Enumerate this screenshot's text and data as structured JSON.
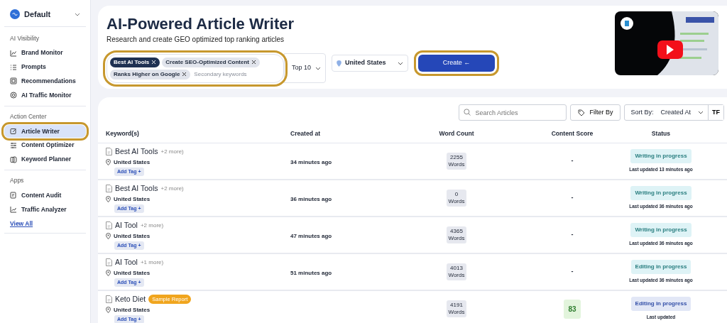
{
  "workspace": {
    "name": "Default"
  },
  "sidebar": {
    "sections": [
      {
        "title": "AI Visibility",
        "items": [
          {
            "label": "Brand Monitor",
            "selected": false
          },
          {
            "label": "Prompts",
            "selected": false
          },
          {
            "label": "Recommendations",
            "selected": false
          },
          {
            "label": "AI Traffic Monitor",
            "selected": false
          }
        ]
      },
      {
        "title": "Action Center",
        "items": [
          {
            "label": "Article Writer",
            "selected": true
          },
          {
            "label": "Content Optimizer",
            "selected": false
          },
          {
            "label": "Keyword Planner",
            "selected": false
          }
        ]
      },
      {
        "title": "Apps",
        "items": [
          {
            "label": "Content Audit",
            "selected": false
          },
          {
            "label": "Traffic Analyzer",
            "selected": false
          }
        ]
      }
    ],
    "view_all": "View All"
  },
  "header": {
    "title": "AI-Powered Article Writer",
    "subtitle": "Research and create GEO optimized top ranking articles"
  },
  "form": {
    "keywords": [
      {
        "label": "Best AI Tools",
        "primary": true
      },
      {
        "label": "Create SEO-Optimized Content",
        "primary": false
      },
      {
        "label": "Ranks Higher on Google",
        "primary": false
      }
    ],
    "secondary_placeholder": "Secondary keywords",
    "top": "Top 10",
    "location": "United States",
    "create_button": "Create ←"
  },
  "toolbar": {
    "search_placeholder": "Search Articles",
    "filter": "Filter By",
    "sort_label": "Sort By:",
    "sort_value": "Created At",
    "tf": "TF"
  },
  "table": {
    "columns": [
      "Keyword(s)",
      "Created at",
      "Word Count",
      "Content Score",
      "Status"
    ],
    "rows": [
      {
        "keyword": "Best AI Tools",
        "more": "+2 more)",
        "tag": null,
        "location": "United States",
        "add_tag": "Add Tag +",
        "created": "34 minutes ago",
        "words": "2255",
        "words_unit": "Words",
        "score": "-",
        "score_highlighted": false,
        "status": "Writing in progress",
        "color": "#def3f6",
        "updated": "Last updated 13 minutes ago"
      },
      {
        "keyword": "Best AI Tools",
        "more": "+2 more)",
        "tag": null,
        "location": "United States",
        "add_tag": "Add Tag +",
        "created": "36 minutes ago",
        "words": "0",
        "words_unit": "Words",
        "score": "-",
        "score_highlighted": false,
        "status": "Writing in progress",
        "color": "#def3f6",
        "updated": "Last updated 36 minutes ago"
      },
      {
        "keyword": "AI Tool",
        "more": "+2 more)",
        "tag": null,
        "location": "United States",
        "add_tag": "Add Tag +",
        "created": "47 minutes ago",
        "words": "4365",
        "words_unit": "Words",
        "score": "-",
        "score_highlighted": false,
        "status": "Writing in progress",
        "color": "#def3f6",
        "updated": "Last updated 36 minutes ago"
      },
      {
        "keyword": "AI Tool",
        "more": "+1 more)",
        "tag": null,
        "location": "United States",
        "add_tag": "Add Tag +",
        "created": "51 minutes ago",
        "words": "4013",
        "words_unit": "Words",
        "score": "-",
        "score_highlighted": false,
        "status": "Editing in progress",
        "color": "#def3f6",
        "updated": "Last updated 36 minutes ago"
      },
      {
        "keyword": "Keto Diet",
        "more": null,
        "tag": "Sample Report",
        "location": "United States",
        "add_tag": "Add Tag +",
        "created": "",
        "words": "4191",
        "words_unit": "Words",
        "score": "83",
        "score_highlighted": true,
        "status": "Editing in progress",
        "color": "#e2e7f6",
        "updated": "Last updated"
      }
    ]
  }
}
